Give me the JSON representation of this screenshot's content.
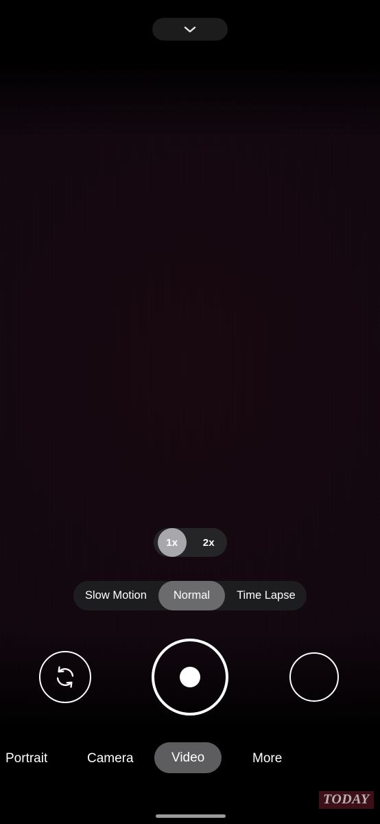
{
  "app": {
    "name": "Camera",
    "colors": {
      "background": "#000000",
      "viewfinder": "#110710",
      "pill_dark": "#1d1d1f",
      "pill_selected": "#6b6b6e",
      "zoom_selected": "#a8a8ac",
      "accent_white": "#ffffff",
      "watermark_bg": "#3d1018",
      "watermark_text": "#b9b2b2"
    }
  },
  "topbar": {
    "expand_button": {
      "icon": "chevron-down-icon",
      "label": ""
    }
  },
  "viewfinder": {
    "preview_label": ""
  },
  "zoom": {
    "options": [
      {
        "label": "1x",
        "selected": true
      },
      {
        "label": "2x",
        "selected": false
      }
    ]
  },
  "video_submodes": {
    "options": [
      {
        "label": "Slow Motion",
        "selected": false
      },
      {
        "label": "Normal",
        "selected": true
      },
      {
        "label": "Time Lapse",
        "selected": false
      }
    ]
  },
  "controls": {
    "flip_camera": {
      "icon": "camera-flip-icon",
      "label": ""
    },
    "shutter": {
      "icon": "record-button-icon",
      "label": ""
    },
    "gallery": {
      "icon": "gallery-thumbnail-icon",
      "label": ""
    }
  },
  "mode_tabs": {
    "items": [
      {
        "label": "Portrait",
        "selected": false
      },
      {
        "label": "Camera",
        "selected": false
      },
      {
        "label": "Video",
        "selected": true
      },
      {
        "label": "More",
        "selected": false
      }
    ]
  },
  "watermark": {
    "text": "TODAY"
  },
  "navigation": {
    "home_indicator": ""
  }
}
